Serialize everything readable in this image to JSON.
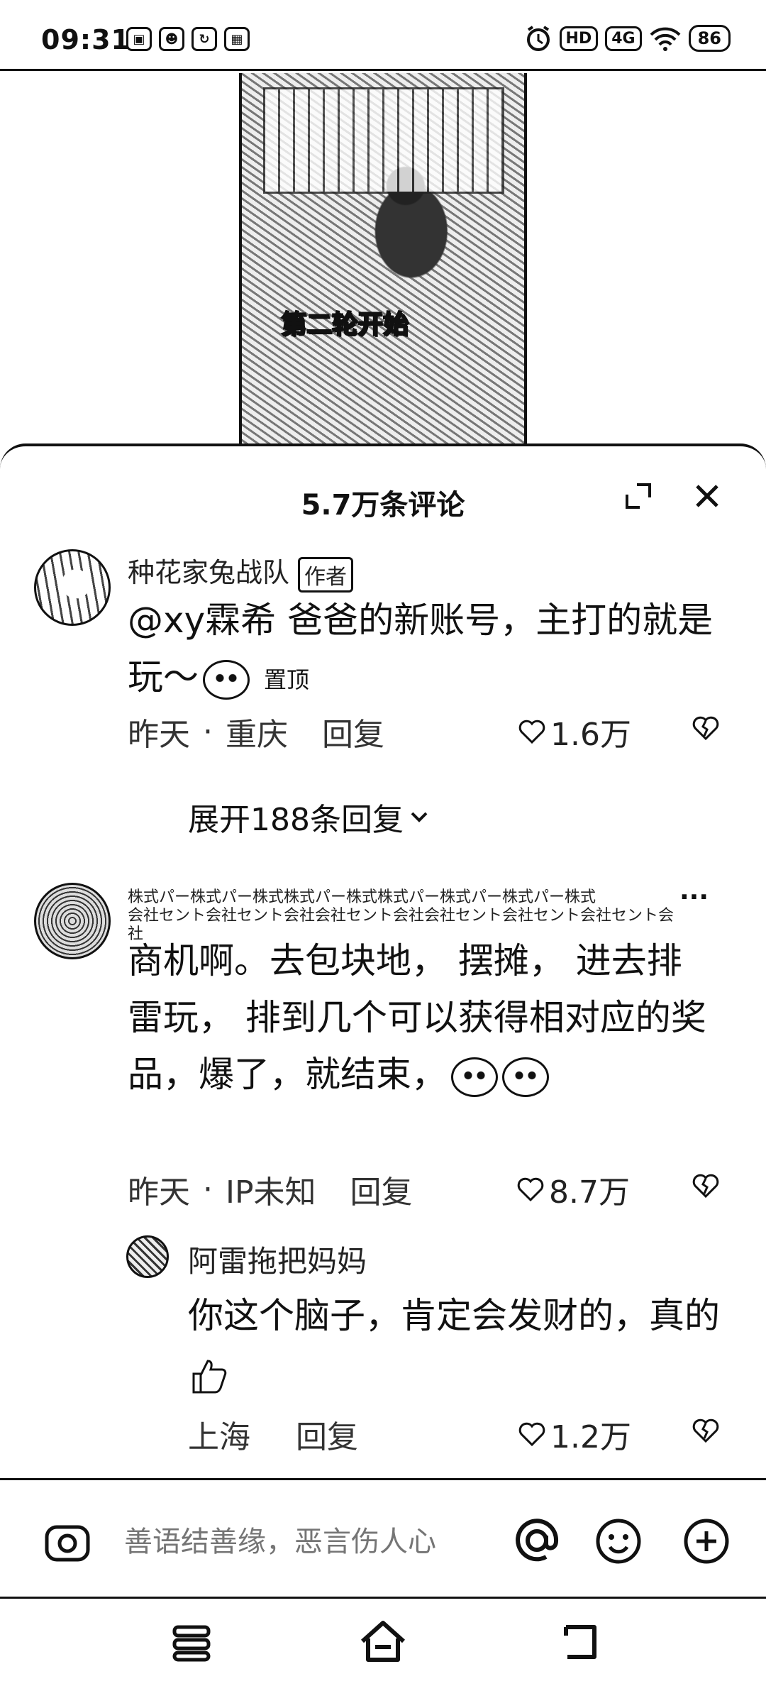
{
  "status_bar": {
    "time": "09:31",
    "left_icons": [
      "▣",
      "☻",
      "↻",
      "▦"
    ],
    "network": "4G",
    "hd": "HD",
    "battery": "86"
  },
  "video": {
    "caption": "第二轮开始"
  },
  "comments_sheet": {
    "title": "5.7万条评论",
    "comments": [
      {
        "username": "种花家兔战队",
        "badge": "作者",
        "text": "@xy霖希 爸爸的新账号，主打的就是玩～",
        "pinned_label": "置顶",
        "time": "昨天",
        "location": "重庆",
        "reply_label": "回复",
        "likes": "1.6万",
        "expand_label": "展开188条回复"
      },
      {
        "username": "株式パー株式パー株式株式パー株式株式パー株式パー株式パー株式\n会社セント会社セント会社会社セント会社会社セント会社セント会社セント会社",
        "more": "···",
        "text": "商机啊。去包块地， 摆摊， 进去排雷玩， 排到几个可以获得相对应的奖品，爆了，就结束，",
        "time": "昨天",
        "location": "IP未知",
        "reply_label": "回复",
        "likes": "8.7万",
        "reply": {
          "username": "阿雷拖把妈妈",
          "text": "你这个脑子，肯定会发财的，真的",
          "location": "上海",
          "reply_label": "回复",
          "likes": "1.2万"
        }
      }
    ]
  },
  "input_bar": {
    "placeholder": "善语结善缘，恶言伤人心"
  }
}
